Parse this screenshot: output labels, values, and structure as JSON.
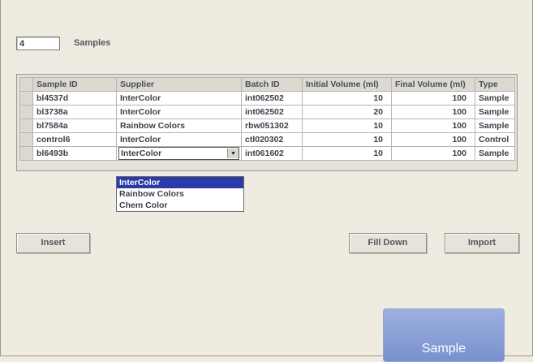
{
  "samples": {
    "count_value": "4",
    "label": "Samples"
  },
  "table": {
    "headers": [
      "Sample ID",
      "Supplier",
      "Batch ID",
      "Initial Volume (ml)",
      "Final Volume (ml)",
      "Type"
    ],
    "rows": [
      [
        "bl4537d",
        "InterColor",
        "int062502",
        "10",
        "100",
        "Sample"
      ],
      [
        "bl3738a",
        "InterColor",
        "int062502",
        "20",
        "100",
        "Sample"
      ],
      [
        "bl7584a",
        "Rainbow Colors",
        "rbw051302",
        "10",
        "100",
        "Sample"
      ],
      [
        "control6",
        "InterColor",
        "ctl020302",
        "10",
        "100",
        "Control"
      ],
      [
        "bl6493b",
        "InterColor",
        "int061602",
        "10",
        "100",
        "Sample"
      ]
    ]
  },
  "supplier_dropdown": {
    "selected": "InterColor",
    "options": [
      "InterColor",
      "Rainbow Colors",
      "Chem Color"
    ]
  },
  "buttons": {
    "insert": "Insert",
    "fill_down": "Fill Down",
    "import": "Import"
  },
  "tile": {
    "label": "Sample"
  }
}
